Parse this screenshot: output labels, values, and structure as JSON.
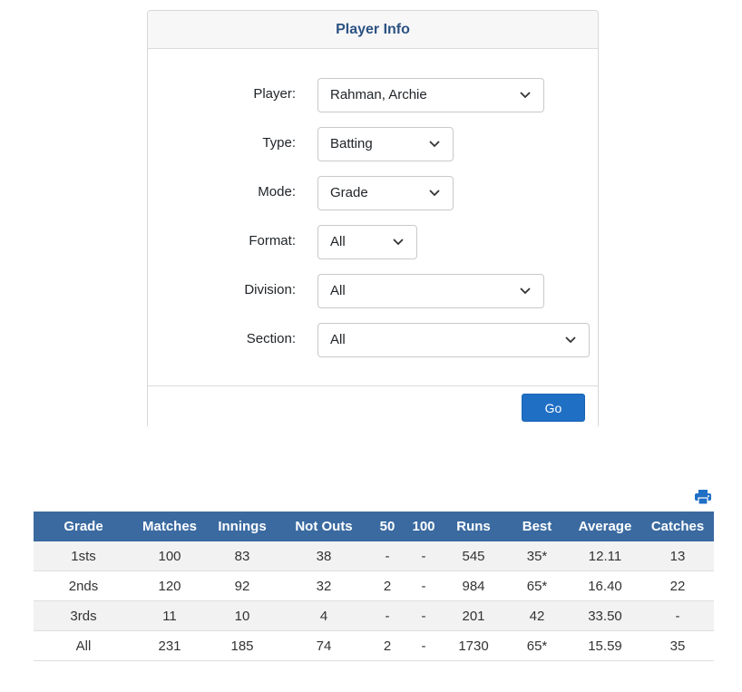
{
  "form": {
    "title": "Player Info",
    "fields": [
      {
        "label": "Player:",
        "value": "Rahman, Archie"
      },
      {
        "label": "Type:",
        "value": "Batting"
      },
      {
        "label": "Mode:",
        "value": "Grade"
      },
      {
        "label": "Format:",
        "value": "All"
      },
      {
        "label": "Division:",
        "value": "All"
      },
      {
        "label": "Section:",
        "value": "All"
      }
    ],
    "go_label": "Go"
  },
  "icons": {
    "print": "print-icon",
    "dropdown": "chevron-down-icon"
  },
  "colors": {
    "header_text": "#2c5282",
    "table_header_bg": "#3a6aa0",
    "button_bg": "#1f6fc5"
  },
  "table": {
    "headers": [
      "Grade",
      "Matches",
      "Innings",
      "Not Outs",
      "50",
      "100",
      "Runs",
      "Best",
      "Average",
      "Catches"
    ],
    "rows": [
      [
        "1sts",
        "100",
        "83",
        "38",
        "-",
        "-",
        "545",
        "35*",
        "12.11",
        "13"
      ],
      [
        "2nds",
        "120",
        "92",
        "32",
        "2",
        "-",
        "984",
        "65*",
        "16.40",
        "22"
      ],
      [
        "3rds",
        "11",
        "10",
        "4",
        "-",
        "-",
        "201",
        "42",
        "33.50",
        "-"
      ],
      [
        "All",
        "231",
        "185",
        "74",
        "2",
        "-",
        "1730",
        "65*",
        "15.59",
        "35"
      ]
    ]
  }
}
